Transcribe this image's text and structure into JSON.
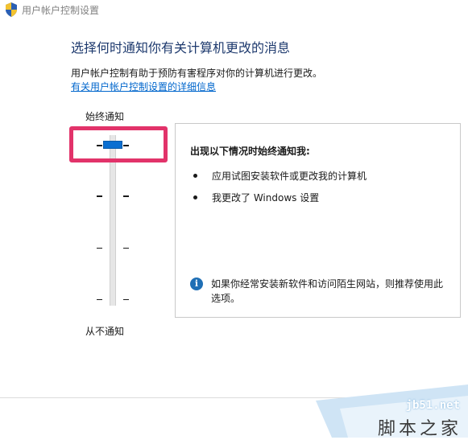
{
  "window": {
    "title": "用户帐户控制设置",
    "icon": "uac-shield-icon"
  },
  "main": {
    "heading": "选择何时通知你有关计算机更改的消息",
    "description": "用户帐户控制有助于预防有害程序对你的计算机进行更改。",
    "link": "有关用户帐户控制设置的详细信息"
  },
  "slider": {
    "top_label": "始终通知",
    "bottom_label": "从不通知",
    "levels": 4,
    "selected_level": 4,
    "accent_color": "#0b6fd1"
  },
  "info_panel": {
    "title": "出现以下情况时始终通知我:",
    "bullets": [
      "应用试图安装软件或更改我的计算机",
      "我更改了 Windows 设置"
    ],
    "note": "如果你经常安装新软件和访问陌生网站，则推荐使用此选项。",
    "note_icon": "info-icon"
  },
  "watermark": {
    "url": "jb51.net",
    "name": "脚本之家"
  },
  "highlight_color": "#e2336a"
}
